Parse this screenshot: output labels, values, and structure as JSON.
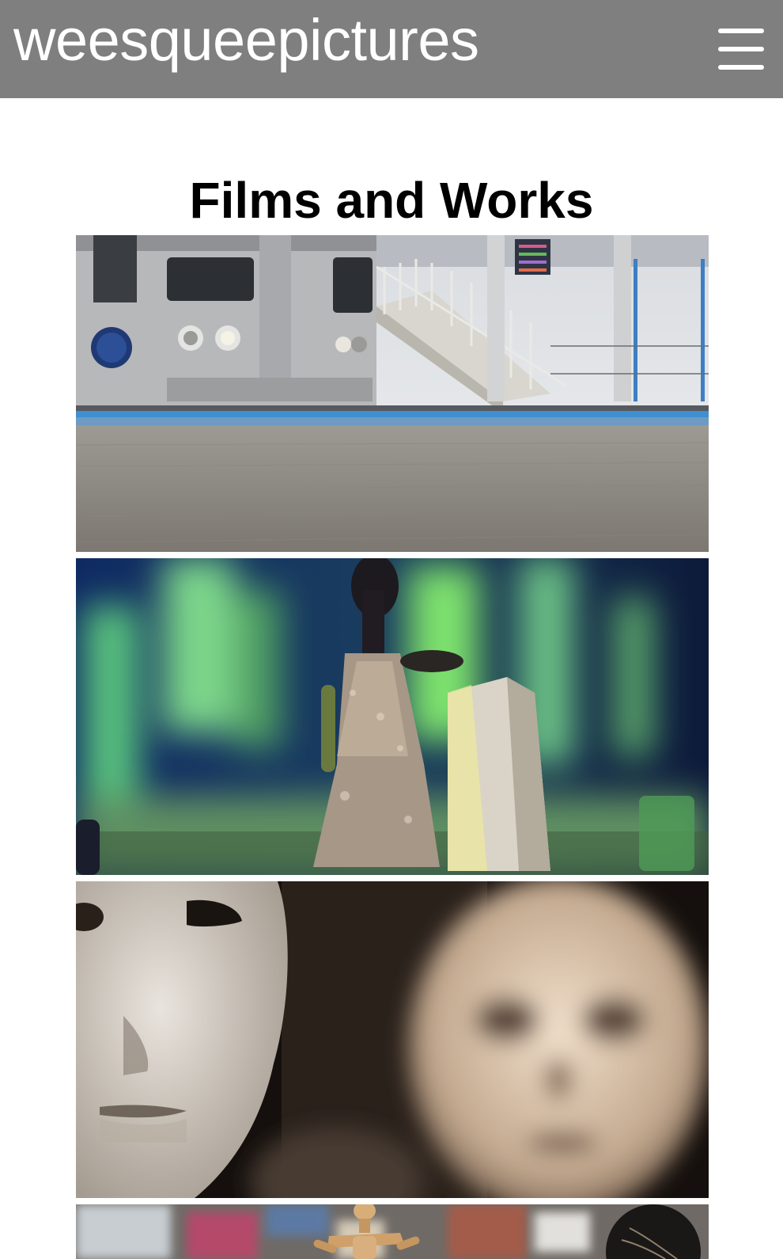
{
  "header": {
    "site_title": "weesqueepictures",
    "background": "#7f7f7f",
    "menu_icon": "hamburger-menu-icon"
  },
  "main": {
    "page_title": "Films and Works"
  },
  "gallery": {
    "items": [
      {
        "thumbnail": "train-platform-thumbnail"
      },
      {
        "thumbnail": "puppet-graveyard-thumbnail"
      },
      {
        "thumbnail": "masks-thumbnail"
      },
      {
        "thumbnail": "wooden-mannequin-thumbnail"
      }
    ]
  }
}
